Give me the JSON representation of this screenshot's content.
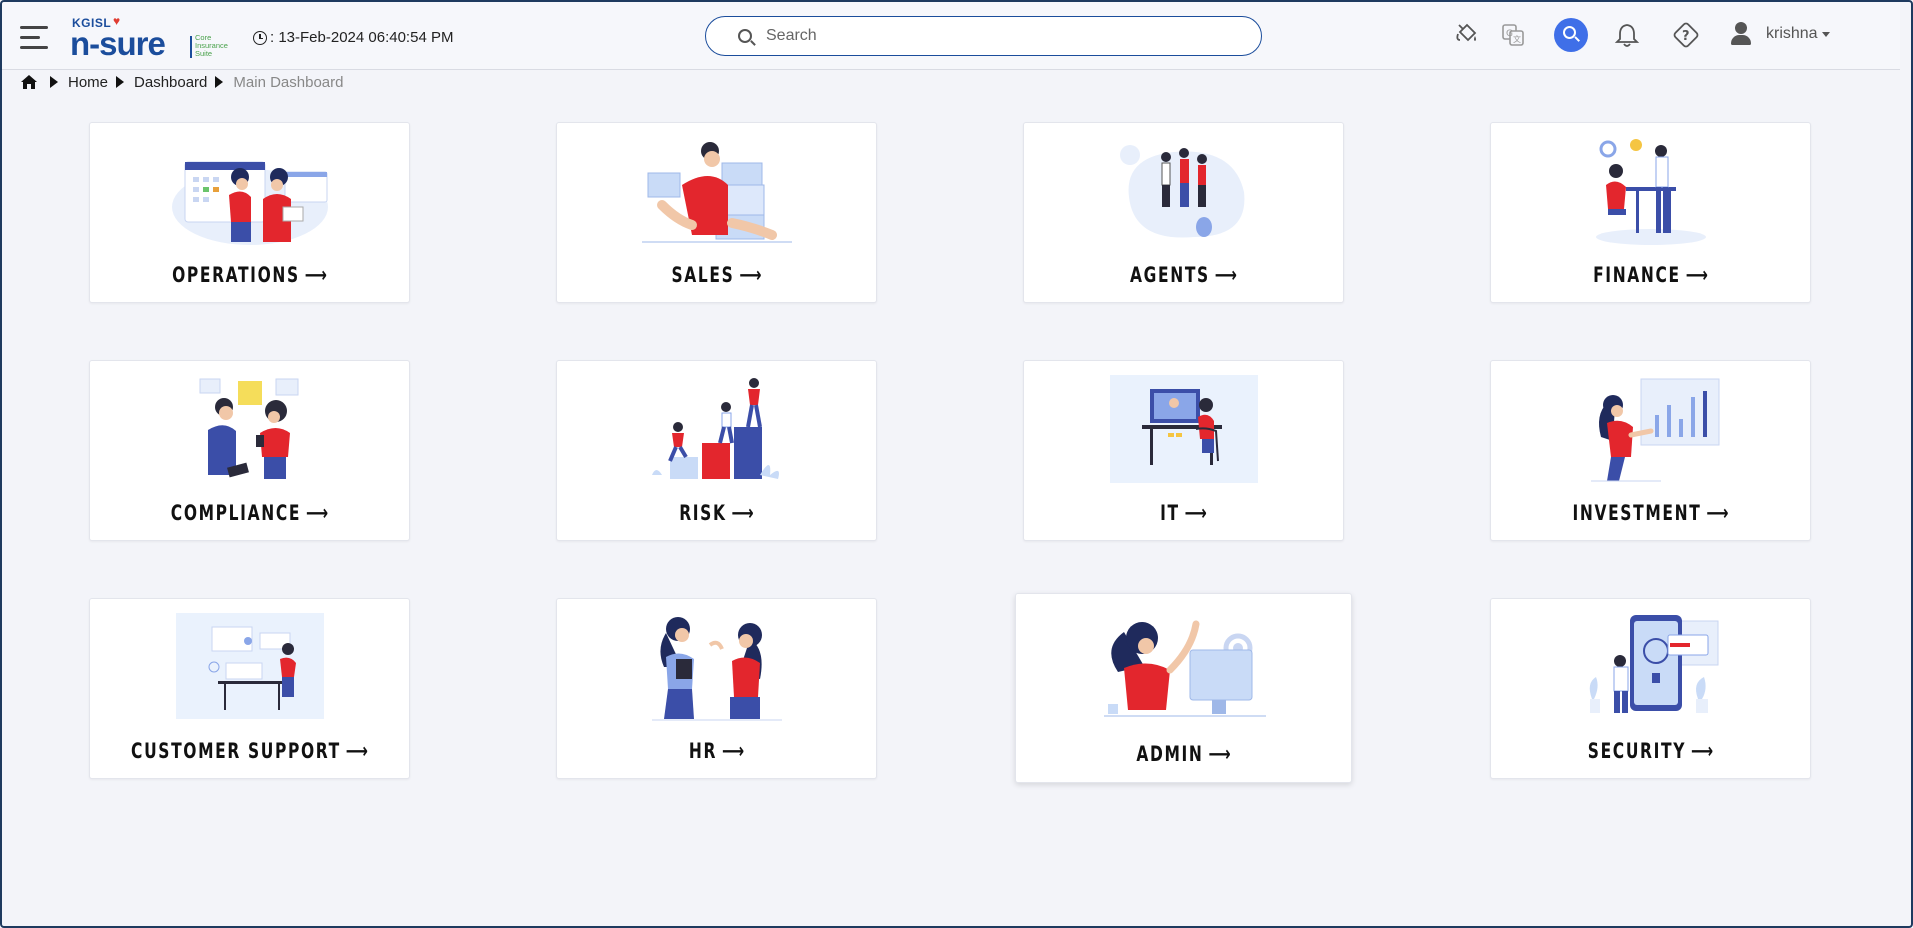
{
  "header": {
    "logo_brand": "KGISL",
    "logo_product": "n-sure",
    "logo_tagline": "Core Insurance Suite",
    "datetime": ": 13-Feb-2024 06:40:54 PM",
    "search_placeholder": "Search",
    "username": "krishna",
    "accent_color": "#3f6fe8",
    "icons": [
      "hamburger-menu-icon",
      "paint-bucket-icon",
      "translate-icon",
      "search-icon",
      "bell-icon",
      "help-icon",
      "user-icon"
    ]
  },
  "breadcrumb": {
    "items": [
      "Home",
      "Dashboard"
    ],
    "current": "Main Dashboard"
  },
  "cards": [
    {
      "label": "OPERATIONS",
      "arrow": "⟶"
    },
    {
      "label": "SALES",
      "arrow": "⟶"
    },
    {
      "label": "AGENTS",
      "arrow": "⟶"
    },
    {
      "label": "FINANCE",
      "arrow": "⟶"
    },
    {
      "label": "COMPLIANCE",
      "arrow": "⟶"
    },
    {
      "label": "RISK",
      "arrow": "⟶"
    },
    {
      "label": "IT",
      "arrow": "⟶"
    },
    {
      "label": "INVESTMENT",
      "arrow": "⟶"
    },
    {
      "label": "CUSTOMER SUPPORT",
      "arrow": "⟶"
    },
    {
      "label": "HR",
      "arrow": "⟶"
    },
    {
      "label": "ADMIN",
      "arrow": "⟶"
    },
    {
      "label": "SECURITY",
      "arrow": "⟶"
    }
  ]
}
